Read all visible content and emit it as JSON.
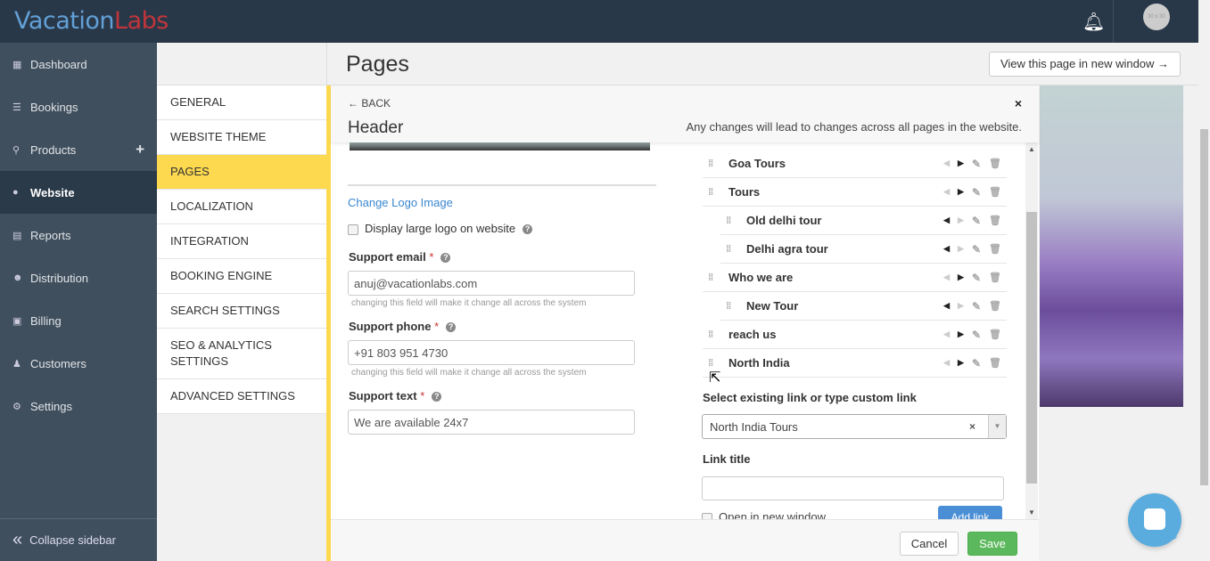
{
  "topbar": {
    "logo_part1": "Vacation",
    "logo_part2": "Labs",
    "avatar_text": "30 x 30",
    "bell_icon": "bell-icon"
  },
  "sidebar": {
    "items": [
      {
        "label": "Dashboard",
        "icon": "calendar-icon"
      },
      {
        "label": "Bookings",
        "icon": "list-icon"
      },
      {
        "label": "Products",
        "icon": "map-pin-icon"
      },
      {
        "label": "Website",
        "icon": "globe-icon"
      },
      {
        "label": "Reports",
        "icon": "report-icon"
      },
      {
        "label": "Distribution",
        "icon": "users-icon"
      },
      {
        "label": "Billing",
        "icon": "money-icon"
      },
      {
        "label": "Customers",
        "icon": "user-icon"
      },
      {
        "label": "Settings",
        "icon": "gear-icon"
      }
    ],
    "active": "Website",
    "collapse_label": "Collapse sidebar"
  },
  "page": {
    "title": "Pages",
    "view_button": "View this page in new window →"
  },
  "submenu": {
    "items": [
      "GENERAL",
      "WEBSITE THEME",
      "PAGES",
      "LOCALIZATION",
      "INTEGRATION",
      "BOOKING ENGINE",
      "SEARCH SETTINGS",
      "SEO & ANALYTICS SETTINGS",
      "ADVANCED SETTINGS"
    ],
    "active": "PAGES"
  },
  "panel": {
    "back": "← BACK",
    "title": "Header",
    "note": "Any changes will lead to changes across all pages in the website.",
    "close": "×",
    "change_logo": "Change Logo Image",
    "large_logo_label": "Display large logo on website",
    "support_email_label": "Support email",
    "support_email_value": "anuj@vacationlabs.com",
    "support_phone_label": "Support phone",
    "support_phone_value": "+91 803 951 4730",
    "support_text_label": "Support text",
    "support_text_value": "We are available 24x7",
    "hint": "changing this field will make it change all across the system",
    "required": "*",
    "menu_items": [
      {
        "label": "Goa Tours",
        "child": false
      },
      {
        "label": "Tours",
        "child": false
      },
      {
        "label": "Old delhi tour",
        "child": true
      },
      {
        "label": "Delhi agra tour",
        "child": true
      },
      {
        "label": "Who we are",
        "child": false
      },
      {
        "label": "New Tour",
        "child": true
      },
      {
        "label": "reach us",
        "child": false
      },
      {
        "label": "North India",
        "child": false
      }
    ],
    "select_label": "Select existing link or type custom link",
    "select_value": "North India Tours",
    "link_title_label": "Link title",
    "link_title_value": "",
    "open_new_window": "Open in new window",
    "add_link": "Add link",
    "cancel": "Cancel",
    "save": "Save"
  },
  "colors": {
    "topbar": "#293849",
    "sidebar": "#404f5d",
    "accent_yellow": "#fdd94f",
    "link_blue": "#3a87d0",
    "save_green": "#5cb85c"
  }
}
